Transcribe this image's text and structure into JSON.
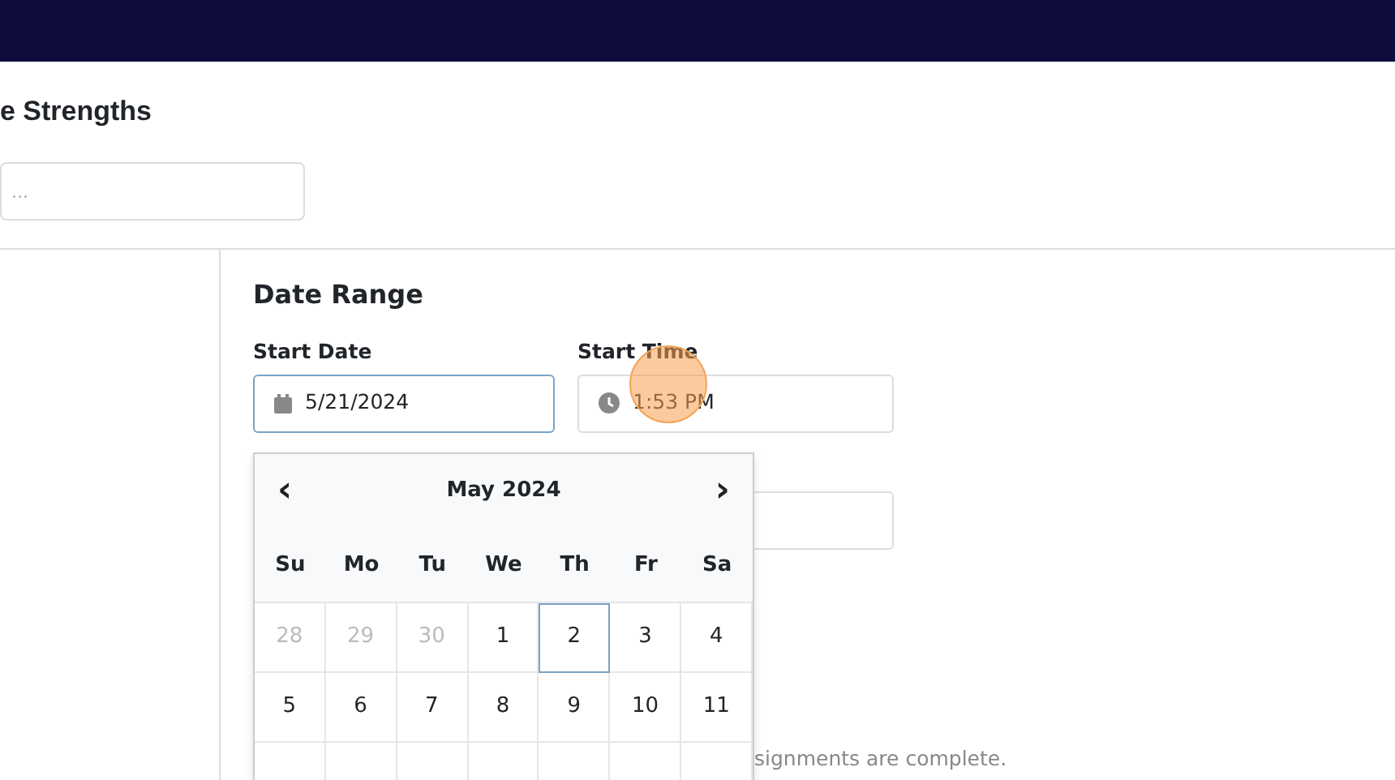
{
  "page_title": "e Strengths",
  "search": {
    "placeholder": "..."
  },
  "section_title": "Date Range",
  "start_date": {
    "label": "Start Date",
    "value": "5/21/2024",
    "focused": true
  },
  "start_time": {
    "label": "Start Time",
    "value": "1:53 PM"
  },
  "note": "signments are complete.",
  "calendar": {
    "month": "May 2024",
    "prev": "‹",
    "next": "›",
    "weekdays": [
      "Su",
      "Mo",
      "Tu",
      "We",
      "Th",
      "Fr",
      "Sa"
    ],
    "weeks": [
      [
        {
          "day": "28",
          "other_month": true,
          "focused": false
        },
        {
          "day": "29",
          "other_month": true,
          "focused": false
        },
        {
          "day": "30",
          "other_month": true,
          "focused": false
        },
        {
          "day": "1",
          "other_month": false,
          "focused": false
        },
        {
          "day": "2",
          "other_month": false,
          "focused": true
        },
        {
          "day": "3",
          "other_month": false,
          "focused": false
        },
        {
          "day": "4",
          "other_month": false,
          "focused": false
        }
      ],
      [
        {
          "day": "5",
          "other_month": false,
          "focused": false
        },
        {
          "day": "6",
          "other_month": false,
          "focused": false
        },
        {
          "day": "7",
          "other_month": false,
          "focused": false
        },
        {
          "day": "8",
          "other_month": false,
          "focused": false
        },
        {
          "day": "9",
          "other_month": false,
          "focused": false
        },
        {
          "day": "10",
          "other_month": false,
          "focused": false
        },
        {
          "day": "11",
          "other_month": false,
          "focused": false
        }
      ]
    ]
  }
}
